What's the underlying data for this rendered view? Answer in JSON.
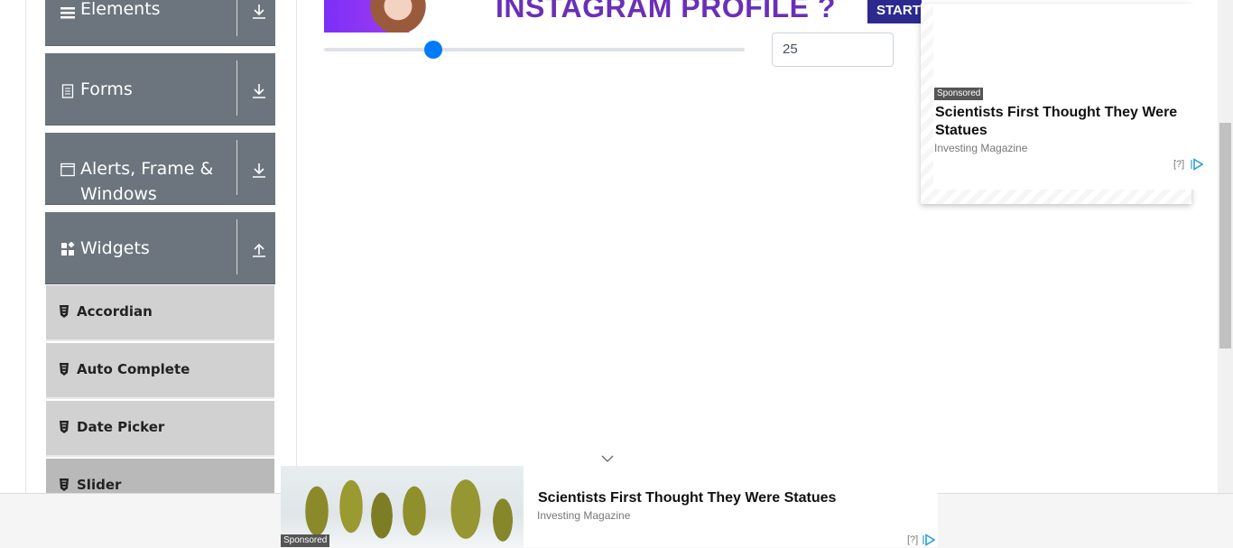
{
  "sidebar": {
    "groups": [
      {
        "label": "Elements",
        "icon": "hamburger-icon"
      },
      {
        "label": "Forms",
        "icon": "document-icon"
      },
      {
        "label": "Alerts, Frame &",
        "label2": "Windows",
        "icon": "window-icon"
      },
      {
        "label": "Widgets",
        "icon": "widgets-icon"
      }
    ],
    "items": [
      {
        "label": "Accordian"
      },
      {
        "label": "Auto Complete"
      },
      {
        "label": "Date Picker"
      },
      {
        "label": "Slider"
      }
    ]
  },
  "banner": {
    "headline": "INSTAGRAM PROFILE ?",
    "button": "START"
  },
  "slider": {
    "value": "25",
    "fraction": 0.25
  },
  "ad_right": {
    "sponsored": "Sponsored",
    "title_line1": "Scientists First Thought They Were",
    "title_line2": "Statues",
    "source": "Investing Magazine",
    "info": "[?]"
  },
  "ad_bottom": {
    "sponsored": "Sponsored",
    "title": "Scientists First Thought They Were Statues",
    "source": "Investing Magazine",
    "info": "[?]"
  },
  "colors": {
    "sidebar_group": "#6c757d",
    "sidebar_item": "#d1d1d1",
    "slider_accent": "#007bff"
  }
}
